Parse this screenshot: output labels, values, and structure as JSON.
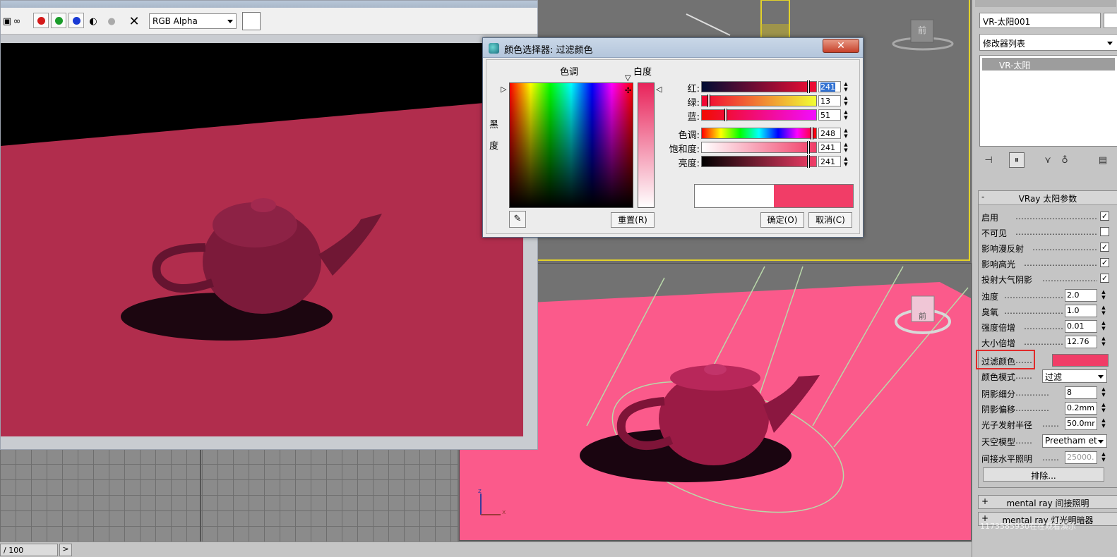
{
  "render_window": {
    "channel": "RGB Alpha",
    "toolbar_colors": {
      "red": "#d41a1a",
      "green": "#1a9c2a",
      "blue": "#1a3ad4"
    }
  },
  "color_dialog": {
    "title": "颜色选择器: 过滤颜色",
    "close_label": "✕",
    "hue_label": "色调",
    "whiteness_label": "白度",
    "blackness_label": "黑度",
    "reset_label": "重置(R)",
    "ok_label": "确定(O)",
    "cancel_label": "取消(C)",
    "sliders": [
      {
        "label": "红:",
        "value": "241",
        "level": 0.945
      },
      {
        "label": "绿:",
        "value": "13",
        "level": 0.05
      },
      {
        "label": "蓝:",
        "value": "51",
        "level": 0.2
      },
      {
        "label": "色调:",
        "value": "248",
        "level": 0.973
      },
      {
        "label": "饱和度:",
        "value": "241",
        "level": 0.945
      },
      {
        "label": "亮度:",
        "value": "241",
        "level": 0.945
      }
    ],
    "old_color": "#ffffff",
    "new_color": "#f13d67"
  },
  "command_panel": {
    "object_name": "VR-太阳001",
    "modifier_list": "修改器列表",
    "stack_item": "VR-太阳",
    "rollout_title": "VRay 太阳参数",
    "params": {
      "enabled": {
        "label": "启用",
        "checked": "✓"
      },
      "invisible": {
        "label": "不可见",
        "checked": ""
      },
      "affect_diffuse": {
        "label": "影响漫反射",
        "checked": "✓"
      },
      "affect_specular": {
        "label": "影响高光",
        "checked": "✓"
      },
      "cast_atmos": {
        "label": "投射大气阴影",
        "checked": "✓"
      },
      "turbidity": {
        "label": "浊度",
        "value": "2.0"
      },
      "ozone": {
        "label": "臭氧",
        "value": "1.0"
      },
      "intensity": {
        "label": "强度倍增",
        "value": "0.01"
      },
      "size": {
        "label": "大小倍增",
        "value": "12.76"
      },
      "filter_color": {
        "label": "过滤颜色",
        "color": "#f13d67"
      },
      "color_mode": {
        "label": "颜色模式",
        "value": "过滤"
      },
      "shadow_subdivs": {
        "label": "阴影细分",
        "value": "8"
      },
      "shadow_bias": {
        "label": "阴影偏移",
        "value": "0.2mm"
      },
      "photon_radius": {
        "label": "光子发射半径",
        "value": "50.0mr"
      },
      "sky_model": {
        "label": "天空模型",
        "value": "Preetham et"
      },
      "indirect_horiz": {
        "label": "间接水平照明",
        "value": "25000."
      }
    },
    "exclude_label": "排除...",
    "sub_rollouts": [
      "mental ray 间接照明",
      "mental ray 灯光明暗器"
    ]
  },
  "status_bar": {
    "frame": "/ 100",
    "next": ">"
  },
  "viewport": {
    "view_cube_label": "前",
    "cube_top_label": "前",
    "axis_z": "z",
    "axis_x": "x"
  },
  "watermark": "1173585930在在观看演示"
}
